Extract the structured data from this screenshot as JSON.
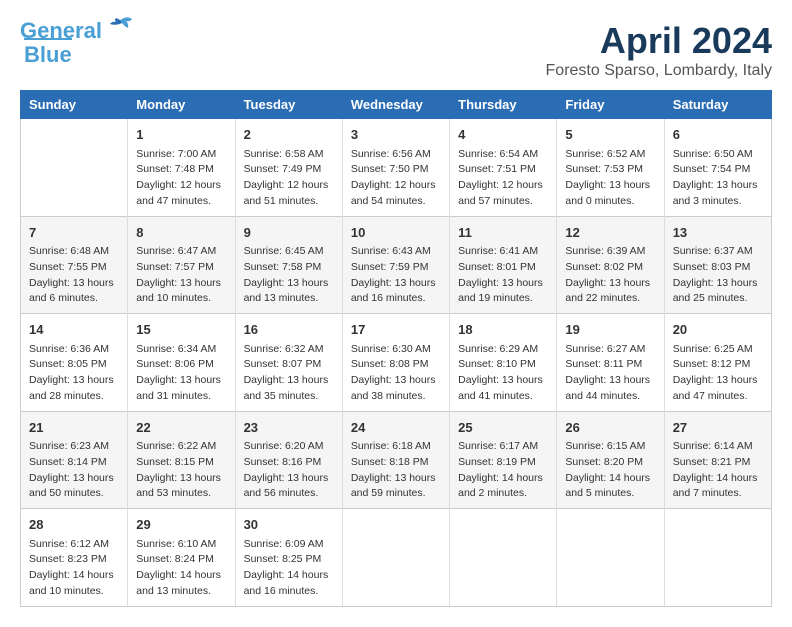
{
  "header": {
    "logo": {
      "line1": "General",
      "line2": "Blue"
    },
    "title": "April 2024",
    "subtitle": "Foresto Sparso, Lombardy, Italy"
  },
  "weekdays": [
    "Sunday",
    "Monday",
    "Tuesday",
    "Wednesday",
    "Thursday",
    "Friday",
    "Saturday"
  ],
  "weeks": [
    [
      {
        "day": "",
        "info": ""
      },
      {
        "day": "1",
        "info": "Sunrise: 7:00 AM\nSunset: 7:48 PM\nDaylight: 12 hours\nand 47 minutes."
      },
      {
        "day": "2",
        "info": "Sunrise: 6:58 AM\nSunset: 7:49 PM\nDaylight: 12 hours\nand 51 minutes."
      },
      {
        "day": "3",
        "info": "Sunrise: 6:56 AM\nSunset: 7:50 PM\nDaylight: 12 hours\nand 54 minutes."
      },
      {
        "day": "4",
        "info": "Sunrise: 6:54 AM\nSunset: 7:51 PM\nDaylight: 12 hours\nand 57 minutes."
      },
      {
        "day": "5",
        "info": "Sunrise: 6:52 AM\nSunset: 7:53 PM\nDaylight: 13 hours\nand 0 minutes."
      },
      {
        "day": "6",
        "info": "Sunrise: 6:50 AM\nSunset: 7:54 PM\nDaylight: 13 hours\nand 3 minutes."
      }
    ],
    [
      {
        "day": "7",
        "info": "Sunrise: 6:48 AM\nSunset: 7:55 PM\nDaylight: 13 hours\nand 6 minutes."
      },
      {
        "day": "8",
        "info": "Sunrise: 6:47 AM\nSunset: 7:57 PM\nDaylight: 13 hours\nand 10 minutes."
      },
      {
        "day": "9",
        "info": "Sunrise: 6:45 AM\nSunset: 7:58 PM\nDaylight: 13 hours\nand 13 minutes."
      },
      {
        "day": "10",
        "info": "Sunrise: 6:43 AM\nSunset: 7:59 PM\nDaylight: 13 hours\nand 16 minutes."
      },
      {
        "day": "11",
        "info": "Sunrise: 6:41 AM\nSunset: 8:01 PM\nDaylight: 13 hours\nand 19 minutes."
      },
      {
        "day": "12",
        "info": "Sunrise: 6:39 AM\nSunset: 8:02 PM\nDaylight: 13 hours\nand 22 minutes."
      },
      {
        "day": "13",
        "info": "Sunrise: 6:37 AM\nSunset: 8:03 PM\nDaylight: 13 hours\nand 25 minutes."
      }
    ],
    [
      {
        "day": "14",
        "info": "Sunrise: 6:36 AM\nSunset: 8:05 PM\nDaylight: 13 hours\nand 28 minutes."
      },
      {
        "day": "15",
        "info": "Sunrise: 6:34 AM\nSunset: 8:06 PM\nDaylight: 13 hours\nand 31 minutes."
      },
      {
        "day": "16",
        "info": "Sunrise: 6:32 AM\nSunset: 8:07 PM\nDaylight: 13 hours\nand 35 minutes."
      },
      {
        "day": "17",
        "info": "Sunrise: 6:30 AM\nSunset: 8:08 PM\nDaylight: 13 hours\nand 38 minutes."
      },
      {
        "day": "18",
        "info": "Sunrise: 6:29 AM\nSunset: 8:10 PM\nDaylight: 13 hours\nand 41 minutes."
      },
      {
        "day": "19",
        "info": "Sunrise: 6:27 AM\nSunset: 8:11 PM\nDaylight: 13 hours\nand 44 minutes."
      },
      {
        "day": "20",
        "info": "Sunrise: 6:25 AM\nSunset: 8:12 PM\nDaylight: 13 hours\nand 47 minutes."
      }
    ],
    [
      {
        "day": "21",
        "info": "Sunrise: 6:23 AM\nSunset: 8:14 PM\nDaylight: 13 hours\nand 50 minutes."
      },
      {
        "day": "22",
        "info": "Sunrise: 6:22 AM\nSunset: 8:15 PM\nDaylight: 13 hours\nand 53 minutes."
      },
      {
        "day": "23",
        "info": "Sunrise: 6:20 AM\nSunset: 8:16 PM\nDaylight: 13 hours\nand 56 minutes."
      },
      {
        "day": "24",
        "info": "Sunrise: 6:18 AM\nSunset: 8:18 PM\nDaylight: 13 hours\nand 59 minutes."
      },
      {
        "day": "25",
        "info": "Sunrise: 6:17 AM\nSunset: 8:19 PM\nDaylight: 14 hours\nand 2 minutes."
      },
      {
        "day": "26",
        "info": "Sunrise: 6:15 AM\nSunset: 8:20 PM\nDaylight: 14 hours\nand 5 minutes."
      },
      {
        "day": "27",
        "info": "Sunrise: 6:14 AM\nSunset: 8:21 PM\nDaylight: 14 hours\nand 7 minutes."
      }
    ],
    [
      {
        "day": "28",
        "info": "Sunrise: 6:12 AM\nSunset: 8:23 PM\nDaylight: 14 hours\nand 10 minutes."
      },
      {
        "day": "29",
        "info": "Sunrise: 6:10 AM\nSunset: 8:24 PM\nDaylight: 14 hours\nand 13 minutes."
      },
      {
        "day": "30",
        "info": "Sunrise: 6:09 AM\nSunset: 8:25 PM\nDaylight: 14 hours\nand 16 minutes."
      },
      {
        "day": "",
        "info": ""
      },
      {
        "day": "",
        "info": ""
      },
      {
        "day": "",
        "info": ""
      },
      {
        "day": "",
        "info": ""
      }
    ]
  ]
}
